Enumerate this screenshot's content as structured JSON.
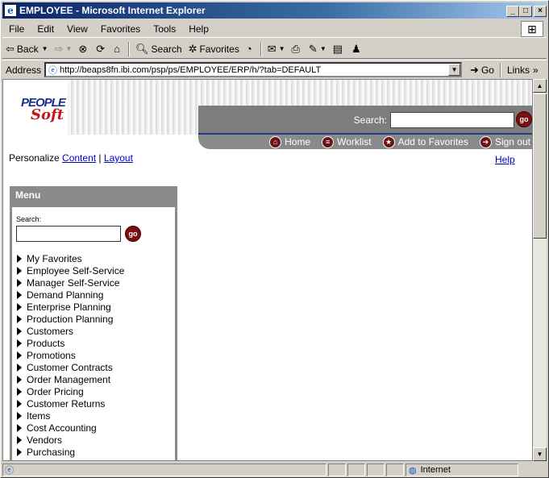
{
  "window": {
    "title": "EMPLOYEE - Microsoft Internet Explorer",
    "min_glyph": "_",
    "max_glyph": "□",
    "close_glyph": "×"
  },
  "menubar": [
    "File",
    "Edit",
    "View",
    "Favorites",
    "Tools",
    "Help"
  ],
  "toolbar": {
    "back": "Back",
    "search": "Search",
    "favorites": "Favorites"
  },
  "address": {
    "label": "Address",
    "url": "http://beaps8fn.ibi.com/psp/ps/EMPLOYEE/ERP/h/?tab=DEFAULT",
    "go": "Go",
    "links": "Links"
  },
  "header": {
    "logo_top": "PEOPLE",
    "logo_bottom": "Soft",
    "search_label": "Search:",
    "go_label": "go",
    "nav": [
      {
        "label": "Home",
        "icon": "home-icon"
      },
      {
        "label": "Worklist",
        "icon": "worklist-icon"
      },
      {
        "label": "Add to Favorites",
        "icon": "add-favorites-icon"
      },
      {
        "label": "Sign out",
        "icon": "sign-out-icon"
      }
    ]
  },
  "personalize": {
    "label": "Personalize",
    "content": "Content",
    "sep": "|",
    "layout": "Layout"
  },
  "help": "Help",
  "menu": {
    "title": "Menu",
    "search_label": "Search:",
    "go_label": "go",
    "items": [
      "My Favorites",
      "Employee Self-Service",
      "Manager Self-Service",
      "Demand Planning",
      "Enterprise Planning",
      "Production Planning",
      "Customers",
      "Products",
      "Promotions",
      "Customer Contracts",
      "Order Management",
      "Order Pricing",
      "Customer Returns",
      "Items",
      "Cost Accounting",
      "Vendors",
      "Purchasing"
    ]
  },
  "status": {
    "zone": "Internet"
  }
}
